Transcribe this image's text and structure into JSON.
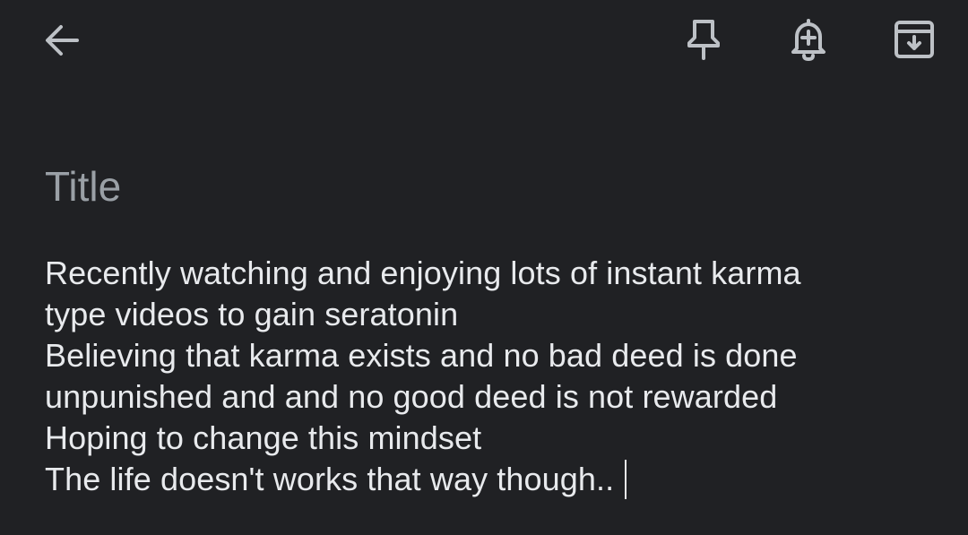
{
  "toolbar": {
    "back_icon": "arrow-back-icon",
    "pin_icon": "pin-icon",
    "reminder_icon": "add-reminder-bell-icon",
    "archive_icon": "archive-icon"
  },
  "note": {
    "title_placeholder": "Title",
    "title_value": "",
    "lines": [
      "Recently watching and enjoying lots of instant karma",
      "type videos to gain seratonin",
      "Believing that karma exists and no bad deed is done",
      "unpunished and and no good deed is not rewarded",
      "Hoping to change this mindset",
      "The life doesn't works that way though.."
    ]
  },
  "colors": {
    "background": "#202124",
    "text": "#e8eaed",
    "placeholder": "#9aa0a6",
    "icon": "#bdc1c6"
  }
}
